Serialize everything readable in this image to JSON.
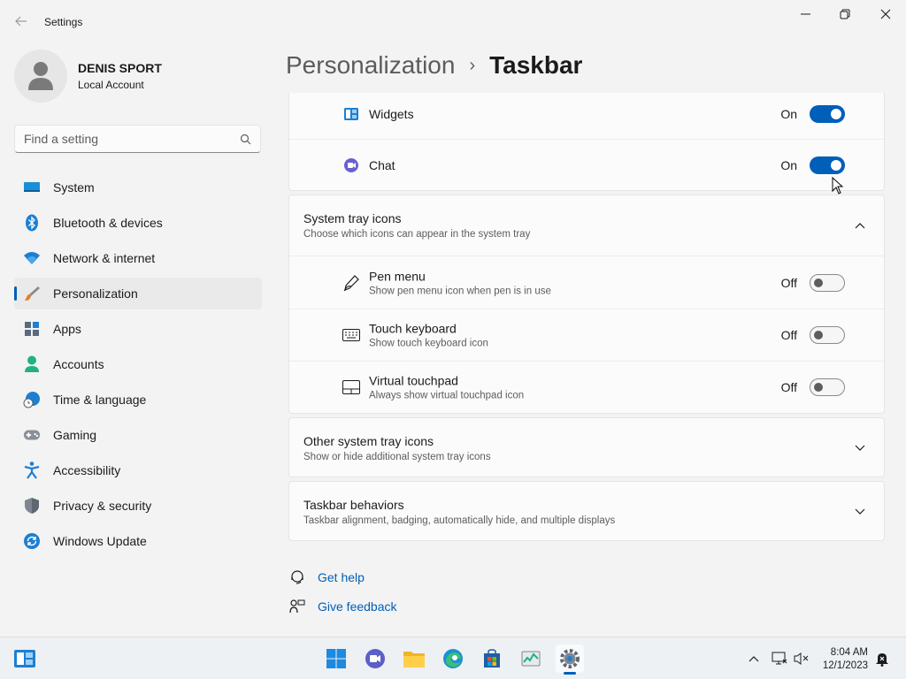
{
  "window": {
    "title": "Settings"
  },
  "profile": {
    "name": "DENIS SPORT",
    "account_type": "Local Account"
  },
  "search": {
    "placeholder": "Find a setting"
  },
  "sidebar": {
    "items": [
      {
        "label": "System",
        "icon": "system-icon"
      },
      {
        "label": "Bluetooth & devices",
        "icon": "bluetooth-icon"
      },
      {
        "label": "Network & internet",
        "icon": "wifi-icon"
      },
      {
        "label": "Personalization",
        "icon": "brush-icon",
        "active": true
      },
      {
        "label": "Apps",
        "icon": "apps-icon"
      },
      {
        "label": "Accounts",
        "icon": "accounts-icon"
      },
      {
        "label": "Time & language",
        "icon": "globe-clock-icon"
      },
      {
        "label": "Gaming",
        "icon": "gamepad-icon"
      },
      {
        "label": "Accessibility",
        "icon": "accessibility-icon"
      },
      {
        "label": "Privacy & security",
        "icon": "shield-icon"
      },
      {
        "label": "Windows Update",
        "icon": "update-icon"
      }
    ]
  },
  "breadcrumb": {
    "parent": "Personalization",
    "separator": "›",
    "current": "Taskbar"
  },
  "taskbar_items": {
    "widgets": {
      "label": "Widgets",
      "state": "On"
    },
    "chat": {
      "label": "Chat",
      "state": "On"
    }
  },
  "system_tray": {
    "title": "System tray icons",
    "subtitle": "Choose which icons can appear in the system tray",
    "items": [
      {
        "label": "Pen menu",
        "sub": "Show pen menu icon when pen is in use",
        "state": "Off"
      },
      {
        "label": "Touch keyboard",
        "sub": "Show touch keyboard icon",
        "state": "Off"
      },
      {
        "label": "Virtual touchpad",
        "sub": "Always show virtual touchpad icon",
        "state": "Off"
      }
    ]
  },
  "other_tray": {
    "title": "Other system tray icons",
    "subtitle": "Show or hide additional system tray icons"
  },
  "behaviors": {
    "title": "Taskbar behaviors",
    "subtitle": "Taskbar alignment, badging, automatically hide, and multiple displays"
  },
  "links": {
    "help": "Get help",
    "feedback": "Give feedback"
  },
  "clock": {
    "time": "8:04 AM",
    "date": "12/1/2023"
  },
  "colors": {
    "accent": "#005fb8",
    "background": "#f3f3f3",
    "card": "#fbfbfb"
  }
}
